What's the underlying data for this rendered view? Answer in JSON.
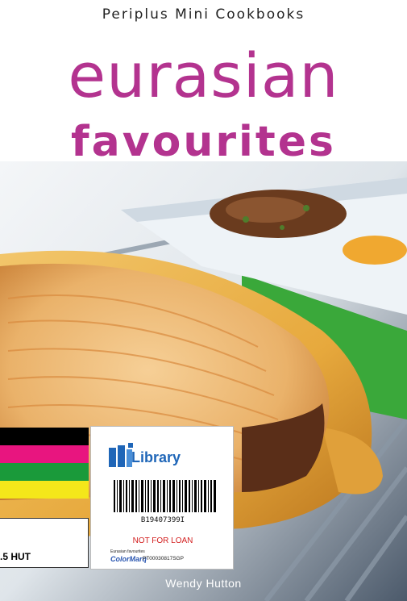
{
  "cover": {
    "series": "Periplus Mini Cookbooks",
    "title_line1": "eurasian",
    "title_line2": "favourites",
    "author": "Wendy Hutton"
  },
  "library_label": {
    "library_text": "Library",
    "barcode_number": "B19407399I",
    "not_for_loan": "NOT FOR LOAN",
    "small_title": "Eurasian favourites",
    "brand": "ColorMarq",
    "code": "PT00030817SGP"
  },
  "call_number": {
    "text": ".5 HUT"
  },
  "spine_stripes": [
    "#000000",
    "#e8157f",
    "#1a9a3a",
    "#f4e71a"
  ],
  "colors": {
    "title": "#b3338f",
    "library_blue": "#1f66b8",
    "not_for_loan": "#d32020"
  }
}
